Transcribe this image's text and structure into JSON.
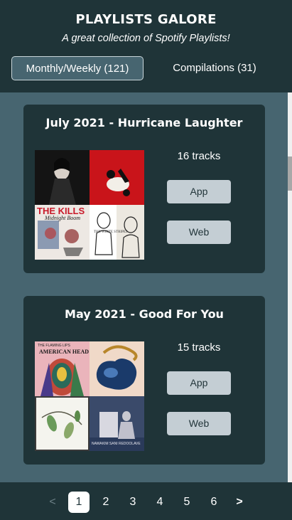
{
  "header": {
    "title": "PLAYLISTS GALORE",
    "subtitle": "A great collection of Spotify Playlists!",
    "tabs": [
      {
        "label": "Monthly/Weekly (121)",
        "active": true
      },
      {
        "label": "Compilations (31)",
        "active": false
      }
    ]
  },
  "playlists": [
    {
      "title": "July 2021 - Hurricane Laughter",
      "tracks": "16 tracks",
      "app_label": "App",
      "web_label": "Web",
      "cover_texts": [
        "THE KILLS",
        "Midnight Boom",
        "THE WHITE STRIPES"
      ]
    },
    {
      "title": "May 2021 - Good For You",
      "tracks": "15 tracks",
      "app_label": "App",
      "web_label": "Web",
      "cover_texts": [
        "THE FLAMING LIPS",
        "AMERICAN HEAD",
        "NAWAKIM SANI REDOOLAVE"
      ]
    }
  ],
  "pagination": {
    "prev": "<",
    "next": ">",
    "pages": [
      "1",
      "2",
      "3",
      "4",
      "5",
      "6"
    ],
    "current": "1"
  },
  "colors": {
    "background": "#476570",
    "panel": "#1f3438",
    "button": "#c4ced4"
  }
}
